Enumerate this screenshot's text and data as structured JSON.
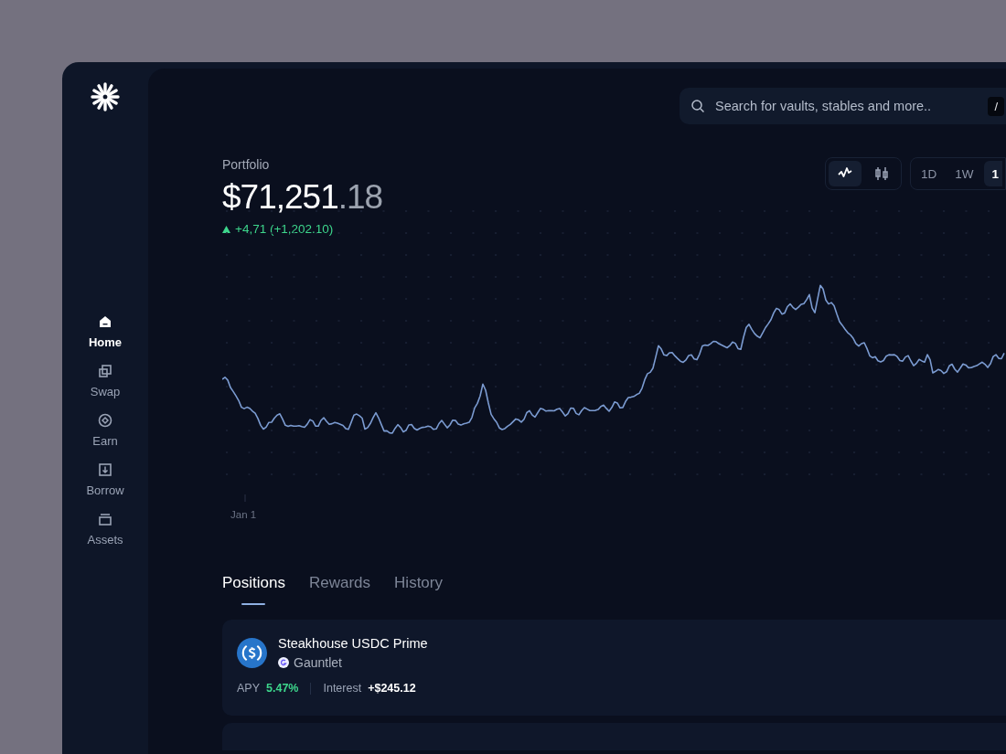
{
  "sidebar": {
    "items": [
      {
        "kind": "home",
        "label": "Home",
        "selected": true
      },
      {
        "kind": "swap",
        "label": "Swap",
        "selected": false
      },
      {
        "kind": "earn",
        "label": "Earn",
        "selected": false
      },
      {
        "kind": "borrow",
        "label": "Borrow",
        "selected": false
      },
      {
        "kind": "assets",
        "label": "Assets",
        "selected": false
      }
    ]
  },
  "search": {
    "placeholder": "Search for vaults, stables and more..",
    "shortcut": "/"
  },
  "portfolio": {
    "title": "Portfolio",
    "value_main": "$71,251",
    "value_cents": ".18",
    "change": "+4,71 (+1,202.10)",
    "positive": true
  },
  "chart_types": [
    {
      "kind": "line",
      "selected": true
    },
    {
      "kind": "candles",
      "selected": false
    }
  ],
  "ranges": [
    {
      "label": "1D",
      "selected": false
    },
    {
      "label": "1W",
      "selected": false
    },
    {
      "label": "1",
      "selected": true
    }
  ],
  "chart": {
    "x_label": "Jan 1"
  },
  "tabs": [
    {
      "label": "Positions",
      "selected": true
    },
    {
      "label": "Rewards",
      "selected": false
    },
    {
      "label": "History",
      "selected": false
    }
  ],
  "positions": [
    {
      "name": "Steakhouse USDC Prime",
      "curator": "Gauntlet",
      "apy_label": "APY",
      "apy": "5.47%",
      "interest_label": "Interest",
      "interest": "+$245.12"
    }
  ]
}
